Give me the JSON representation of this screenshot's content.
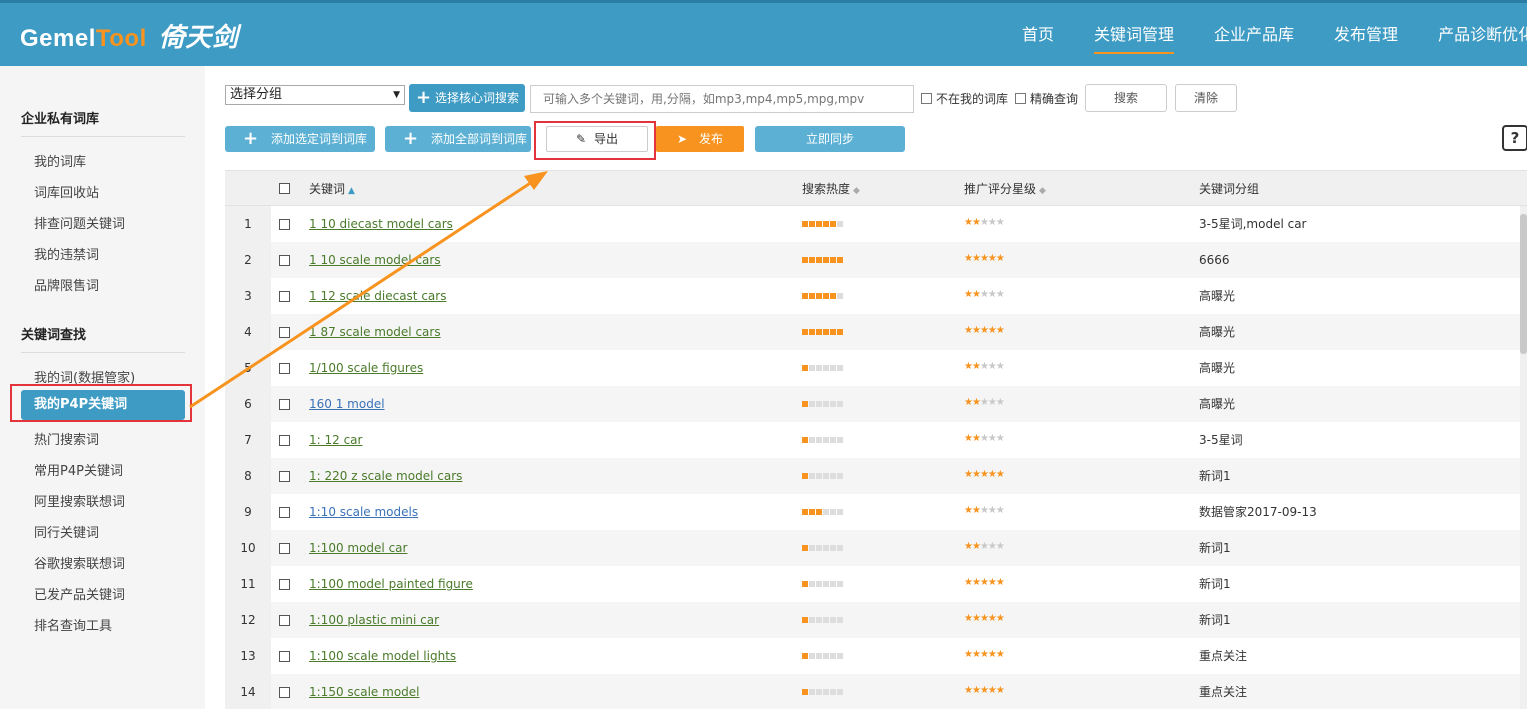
{
  "header": {
    "logo_part1": "Gemel",
    "logo_part2": "Tool",
    "logo_cn": "倚天剑",
    "nav": [
      "首页",
      "关键词管理",
      "企业产品库",
      "发布管理",
      "产品诊断优化"
    ],
    "active_nav": 1
  },
  "sidebar": {
    "section1_title": "企业私有词库",
    "section1_items": [
      "我的词库",
      "词库回收站",
      "排查问题关键词",
      "我的违禁词",
      "品牌限售词"
    ],
    "section2_title": "关键词查找",
    "section2_items": [
      "我的词(数据管家)",
      "我的P4P关键词",
      "热门搜索词",
      "常用P4P关键词",
      "阿里搜索联想词",
      "同行关键词",
      "谷歌搜索联想词",
      "已发产品关键词",
      "排名查询工具"
    ],
    "active_item": "我的P4P关键词"
  },
  "toolbar": {
    "group_select": "选择分组",
    "core_search": "选择核心词搜索",
    "keyword_placeholder": "可输入多个关键词，用,分隔，如mp3,mp4,mp5,mpg,mpv",
    "not_in_lib": "不在我的词库",
    "exact": "精确查询",
    "search": "搜索",
    "clear": "清除",
    "add_selected": "添加选定词到词库",
    "add_all": "添加全部词到词库",
    "export": "导出",
    "publish": "发布",
    "sync": "立即同步",
    "help": "?"
  },
  "table": {
    "headers": {
      "keyword": "关键词",
      "heat": "搜索热度",
      "rating": "推广评分星级",
      "group": "关键词分组"
    },
    "rows": [
      {
        "n": "1",
        "kw": "1 10 diecast model cars",
        "heat": 5,
        "stars": 2,
        "group": "3-5星词,model car"
      },
      {
        "n": "2",
        "kw": "1 10 scale model cars",
        "heat": 6,
        "stars": 5,
        "group": "6666"
      },
      {
        "n": "3",
        "kw": "1 12 scale diecast cars",
        "heat": 5,
        "stars": 2,
        "group": "高曝光"
      },
      {
        "n": "4",
        "kw": "1 87 scale model cars",
        "heat": 6,
        "stars": 5,
        "group": "高曝光"
      },
      {
        "n": "5",
        "kw": "1/100 scale figures",
        "heat": 1,
        "stars": 2,
        "group": "高曝光"
      },
      {
        "n": "6",
        "kw": "160 1 model",
        "heat": 1,
        "stars": 2,
        "group": "高曝光",
        "blue": true
      },
      {
        "n": "7",
        "kw": "1: 12 car",
        "heat": 1,
        "stars": 2,
        "group": "3-5星词"
      },
      {
        "n": "8",
        "kw": "1: 220 z scale model cars",
        "heat": 1,
        "stars": 5,
        "group": "新词1"
      },
      {
        "n": "9",
        "kw": "1:10 scale models",
        "heat": 3,
        "stars": 2,
        "group": "数据管家2017-09-13",
        "blue": true
      },
      {
        "n": "10",
        "kw": "1:100 model car",
        "heat": 1,
        "stars": 2,
        "group": "新词1"
      },
      {
        "n": "11",
        "kw": "1:100 model painted figure",
        "heat": 1,
        "stars": 5,
        "group": "新词1"
      },
      {
        "n": "12",
        "kw": "1:100 plastic mini car",
        "heat": 1,
        "stars": 5,
        "group": "新词1"
      },
      {
        "n": "13",
        "kw": "1:100 scale model lights",
        "heat": 1,
        "stars": 5,
        "group": "重点关注"
      },
      {
        "n": "14",
        "kw": "1:150 scale model",
        "heat": 1,
        "stars": 5,
        "group": "重点关注"
      }
    ]
  },
  "colors": {
    "brand": "#3d9bc4",
    "accent": "#f7931e",
    "highlight": "#e2343a"
  }
}
